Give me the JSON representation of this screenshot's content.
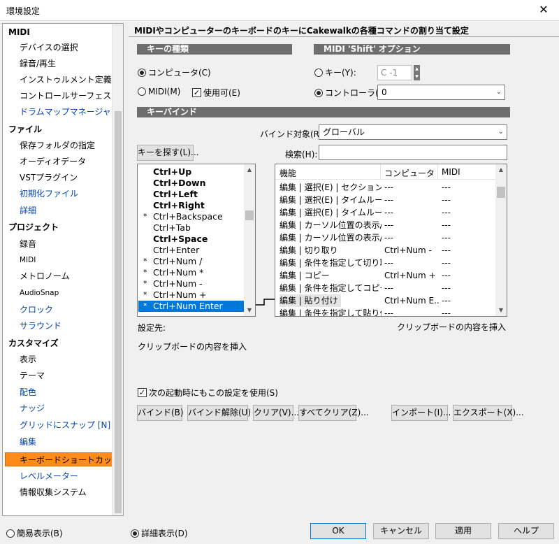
{
  "window": {
    "title": "環境設定",
    "close_glyph": "✕"
  },
  "sidebar": {
    "items": [
      {
        "label": "MIDI",
        "kind": "hdr"
      },
      {
        "label": "デバイスの選択",
        "kind": "item"
      },
      {
        "label": "録音/再生",
        "kind": "item"
      },
      {
        "label": "インストゥルメント定義",
        "kind": "item"
      },
      {
        "label": "コントロールサーフェス",
        "kind": "item"
      },
      {
        "label": "ドラムマップマネージャ",
        "kind": "blue"
      },
      {
        "label": "ファイル",
        "kind": "hdr"
      },
      {
        "label": "保存フォルダの指定",
        "kind": "item"
      },
      {
        "label": "オーディオデータ",
        "kind": "item"
      },
      {
        "label": "VSTプラグイン",
        "kind": "item"
      },
      {
        "label": "初期化ファイル",
        "kind": "blue"
      },
      {
        "label": "詳細",
        "kind": "blue"
      },
      {
        "label": "プロジェクト",
        "kind": "hdr"
      },
      {
        "label": "録音",
        "kind": "item"
      },
      {
        "label": "MIDI",
        "kind": "small"
      },
      {
        "label": "メトロノーム",
        "kind": "item"
      },
      {
        "label": "AudioSnap",
        "kind": "small"
      },
      {
        "label": "クロック",
        "kind": "blue"
      },
      {
        "label": "サラウンド",
        "kind": "blue"
      },
      {
        "label": "カスタマイズ",
        "kind": "hdr"
      },
      {
        "label": "表示",
        "kind": "item"
      },
      {
        "label": "テーマ",
        "kind": "item"
      },
      {
        "label": "配色",
        "kind": "blue"
      },
      {
        "label": "ナッジ",
        "kind": "blue"
      },
      {
        "label": "グリッドにスナップ [N]",
        "kind": "blue"
      },
      {
        "label": "編集",
        "kind": "blue"
      },
      {
        "label": "キーボードショートカット",
        "kind": "sel"
      },
      {
        "label": "レベルメーター",
        "kind": "blue"
      },
      {
        "label": "情報収集システム",
        "kind": "item"
      }
    ]
  },
  "main": {
    "heading": "MIDIやコンピューターのキーボードのキーにCakewalkの各種コマンドの割り当て設定",
    "key_type": {
      "title": "キーの種類",
      "computer": "コンピュータ(C)",
      "midi": "MIDI(M)",
      "enable": "使用可(E)"
    },
    "shift_option": {
      "title": "MIDI 'Shift' オプション",
      "key": "キー(Y):",
      "key_value": "C -1",
      "controller": "コントローラ(N):",
      "controller_value": "0"
    },
    "keybind": {
      "title": "キーバインド",
      "bind_target_label": "バインド対象(R):",
      "bind_target_value": "グローバル",
      "find_key_button": "キーを探す(L)...",
      "search_label": "検索(H):",
      "search_value": ""
    },
    "keys": [
      {
        "label": "Ctrl+Up",
        "star": "",
        "bold": true
      },
      {
        "label": "Ctrl+Down",
        "star": "",
        "bold": true
      },
      {
        "label": "Ctrl+Left",
        "star": "",
        "bold": true
      },
      {
        "label": "Ctrl+Right",
        "star": "",
        "bold": true
      },
      {
        "label": "Ctrl+Backspace",
        "star": "*",
        "bold": false
      },
      {
        "label": "Ctrl+Tab",
        "star": "",
        "bold": false
      },
      {
        "label": "Ctrl+Space",
        "star": "",
        "bold": true
      },
      {
        "label": "Ctrl+Enter",
        "star": "",
        "bold": false
      },
      {
        "label": "Ctrl+Num /",
        "star": "*",
        "bold": false
      },
      {
        "label": "Ctrl+Num *",
        "star": "*",
        "bold": false
      },
      {
        "label": "Ctrl+Num -",
        "star": "*",
        "bold": false
      },
      {
        "label": "Ctrl+Num +",
        "star": "*",
        "bold": false
      },
      {
        "label": "Ctrl+Num Enter",
        "star": "*",
        "bold": false,
        "selected": true
      }
    ],
    "commands_header": [
      "機能",
      "コンピュータ",
      "MIDI"
    ],
    "commands": [
      [
        "編集 | 選択(E) | セクションの...",
        "---",
        "---"
      ],
      [
        "編集 | 選択(E) | タイムルーラ...",
        "---",
        "---"
      ],
      [
        "編集 | 選択(E) | タイムルーラ...",
        "---",
        "---"
      ],
      [
        "編集 | カーソル位置の表示/...",
        "---",
        "---"
      ],
      [
        "編集 | カーソル位置の表示/...",
        "---",
        "---"
      ],
      [
        "編集 | 切り取り",
        "Ctrl+Num -",
        "---"
      ],
      [
        "編集 | 条件を指定して切り取り",
        "---",
        "---"
      ],
      [
        "編集 | コピー",
        "Ctrl+Num +",
        "---"
      ],
      [
        "編集 | 条件を指定してコピー",
        "---",
        "---"
      ],
      [
        "編集 | 貼り付け",
        "Ctrl+Num E...",
        "---"
      ],
      [
        "編集 | 条件を指定して貼り付け",
        "---",
        "---"
      ]
    ],
    "assigned_label": "設定先:",
    "command_description": "クリップボードの内容を挿入",
    "assigned_value": "クリップボードの内容を挿入",
    "use_next_time": "次の起動時にもこの設定を使用(S)",
    "buttons": {
      "bind": "バインド(B)",
      "unbind": "バインド解除(U)",
      "clear": "クリア(V)...",
      "clear_all": "すべてクリア(Z)...",
      "import": "インポート(I)...",
      "export": "エクスポート(X)..."
    }
  },
  "footer": {
    "simple_view": "簡易表示(B)",
    "detail_view": "詳細表示(D)",
    "ok": "OK",
    "cancel": "キャンセル",
    "apply": "適用",
    "help": "ヘルプ"
  }
}
